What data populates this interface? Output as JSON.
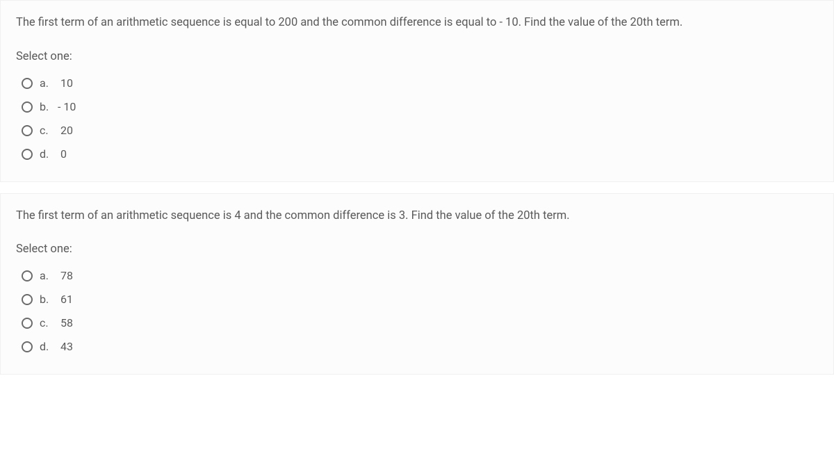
{
  "questions": [
    {
      "text": "The first term of an arithmetic sequence is equal to 200 and the common difference is equal to - 10. Find the value of the 20th term.",
      "prompt": "Select one:",
      "options": [
        {
          "letter": "a.",
          "value": " 10"
        },
        {
          "letter": "b.",
          "value": "- 10"
        },
        {
          "letter": "c.",
          "value": " 20"
        },
        {
          "letter": "d.",
          "value": " 0"
        }
      ]
    },
    {
      "text": "The first term of an arithmetic sequence is 4 and the common difference is 3. Find the value of the 20th term.",
      "prompt": "Select one:",
      "options": [
        {
          "letter": "a.",
          "value": " 78"
        },
        {
          "letter": "b.",
          "value": " 61"
        },
        {
          "letter": "c.",
          "value": " 58"
        },
        {
          "letter": "d.",
          "value": " 43"
        }
      ]
    }
  ]
}
